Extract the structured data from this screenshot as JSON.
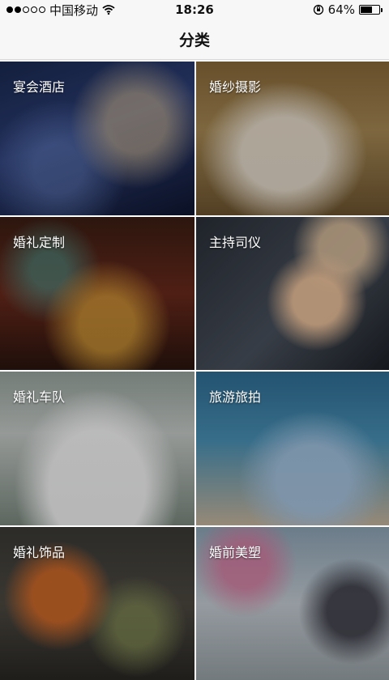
{
  "status_bar": {
    "carrier": "中国移动",
    "time": "18:26",
    "battery_percent": "64%",
    "battery_level": 0.64
  },
  "header": {
    "title": "分类"
  },
  "categories": [
    {
      "label": "宴会酒店",
      "icon": "banquet-hotel-image"
    },
    {
      "label": "婚纱摄影",
      "icon": "wedding-photography-image"
    },
    {
      "label": "婚礼定制",
      "icon": "wedding-customization-image"
    },
    {
      "label": "主持司仪",
      "icon": "emcee-image"
    },
    {
      "label": "婚礼车队",
      "icon": "wedding-car-image"
    },
    {
      "label": "旅游旅拍",
      "icon": "travel-photo-image"
    },
    {
      "label": "婚礼饰品",
      "icon": "wedding-decor-image"
    },
    {
      "label": "婚前美塑",
      "icon": "prewedding-beauty-image"
    }
  ]
}
